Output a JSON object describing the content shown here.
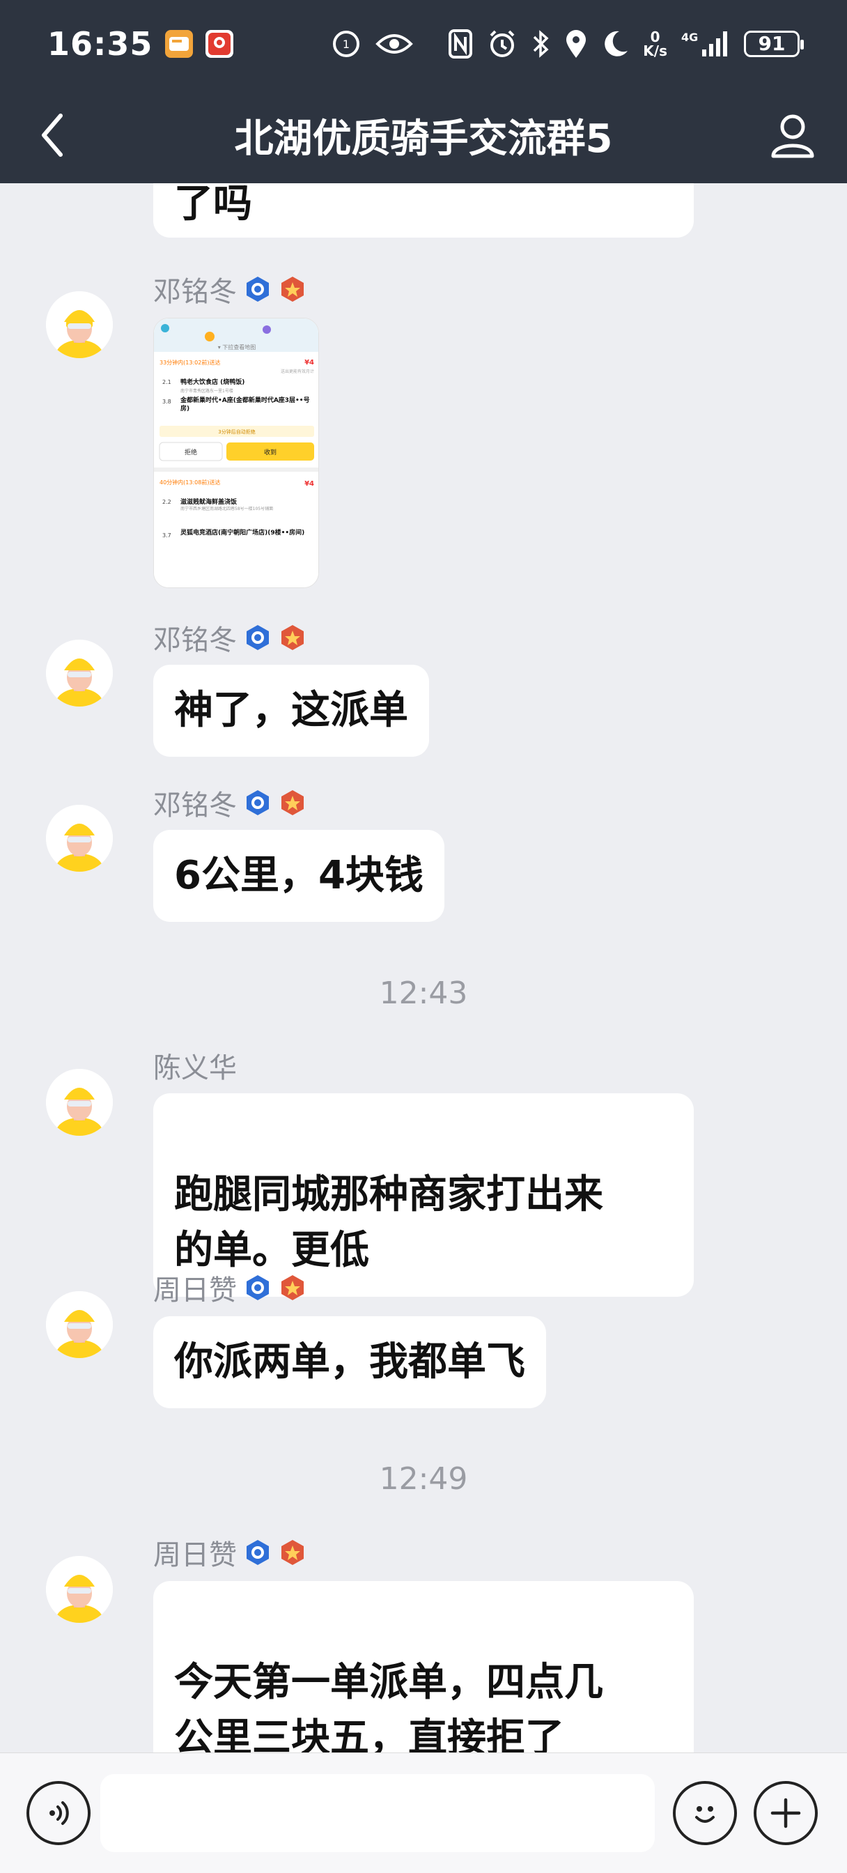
{
  "status_bar": {
    "time": "16:35",
    "net_speed_top": "0",
    "net_speed_bottom": "K/s",
    "network": "4G",
    "battery": "91"
  },
  "nav": {
    "title": "北湖优质骑手交流群5"
  },
  "messages": [
    {
      "type": "text",
      "text": "了吗"
    },
    {
      "type": "image",
      "sender": "邓铭冬",
      "image": {
        "map_label": "下拉查看地图",
        "order1_time": "33分钟内(13:02前)送达",
        "order1_price": "¥4",
        "order1_note": "送出更能有效月计",
        "order1_pickup_dist": "2.1",
        "order1_pickup_unit": "公里",
        "order1_pickup": "鸭老大饮食店 (烧鸭饭)",
        "order1_pickup_addr": "南宁市青秀区路东一里1号楼",
        "order1_drop_dist": "3.8",
        "order1_drop_unit": "公里",
        "order1_drop": "金都新巢时代•A座(金都新巢时代A座3层••号房)",
        "order1_hint": "3分钟后自动拒绝",
        "btn_reject": "拒绝",
        "btn_accept": "收到",
        "order2_time": "40分钟内(13:08前)送达",
        "order2_price": "¥4",
        "order2_pickup_dist": "2.2",
        "order2_pickup": "滋滋贱鱿海鲜盖浇饭",
        "order2_pickup_addr": "南宁市西乡塘区南湖路北四巷58号一楼105号铺面",
        "order2_drop_dist": "3.7",
        "order2_drop": "灵狐电竞酒店(南宁朝阳广场店)(9楼••房间)"
      }
    },
    {
      "type": "text",
      "sender": "邓铭冬",
      "text": "神了，这派单"
    },
    {
      "type": "text",
      "sender": "邓铭冬",
      "text": "6公里，4块钱"
    },
    {
      "type": "time",
      "text": "12:43"
    },
    {
      "type": "text",
      "sender": "陈义华",
      "text": "跑腿同城那种商家打出来\n的单。更低"
    },
    {
      "type": "text",
      "sender": "周日赞",
      "text": "你派两单，我都单飞"
    },
    {
      "type": "time",
      "text": "12:49"
    },
    {
      "type": "text",
      "sender": "周日赞",
      "text": "今天第一单派单，四点几\n公里三块五，直接拒了"
    }
  ],
  "input": {
    "placeholder": ""
  },
  "icons": {
    "back": "chevron-left-icon",
    "members": "person-icon",
    "voice": "voice-icon",
    "emoji": "smile-icon",
    "plus": "plus-icon"
  },
  "colors": {
    "header_bg": "#2d3440",
    "chat_bg": "#edeef2",
    "bubble_bg": "#ffffff",
    "accept_yellow": "#ffd02a"
  }
}
